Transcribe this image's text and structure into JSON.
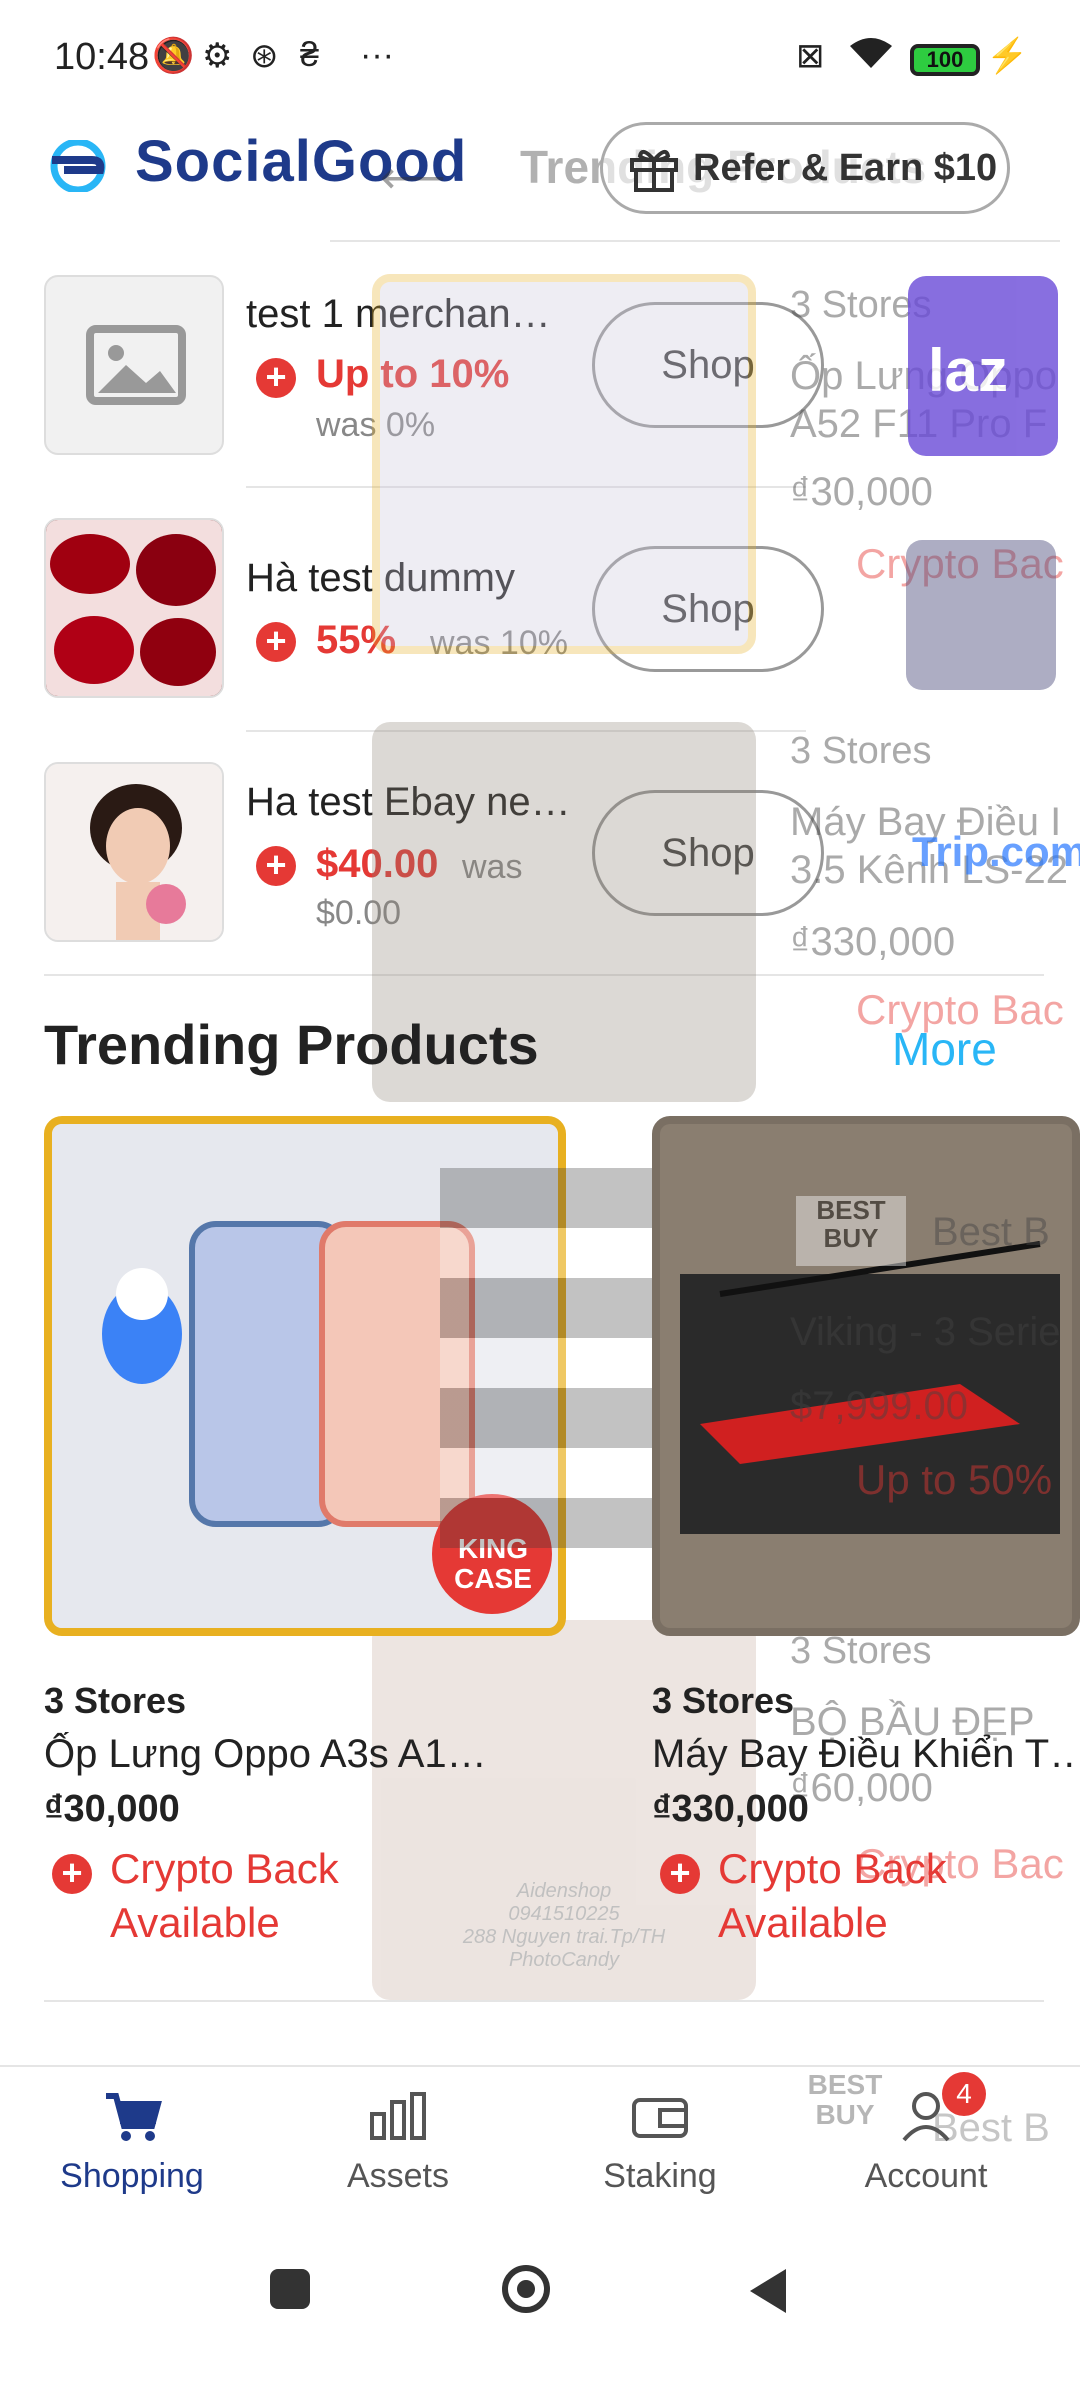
{
  "status_bar": {
    "time": "10:48",
    "battery": "100"
  },
  "header": {
    "brand": "SocialGood",
    "refer_label": "Refer & Earn $10",
    "ghost_title": "Trending Products"
  },
  "merchants": [
    {
      "name": "test 1 merchan…",
      "rate": "Up to 10%",
      "was": "was 0%",
      "shop": "Shop"
    },
    {
      "name": "Hà test dummy",
      "rate": "55%",
      "was": "was 10%",
      "shop": "Shop"
    },
    {
      "name": "Ha test Ebay ne…",
      "rate": "$40.00",
      "was": "was",
      "was2": "$0.00",
      "shop": "Shop"
    }
  ],
  "trending": {
    "title": "Trending Products",
    "more": "More",
    "products": [
      {
        "stores": "3 Stores",
        "name": "Ốp Lưng Oppo A3s A1…",
        "price": "₫30,000",
        "crypto_line1": "Crypto Back",
        "crypto_line2": "Available",
        "overlay": "KING CASE"
      },
      {
        "stores": "3 Stores",
        "name": "Máy Bay Điều Khiển T…",
        "price": "₫330,000",
        "crypto_line1": "Crypto Back",
        "crypto_line2": "Available"
      }
    ]
  },
  "ghost_right": [
    {
      "stores": "3 Stores",
      "name1": "Ốp Lưng Oppo",
      "name2": "A52 F11 Pro F",
      "price": "₫30,000",
      "crypto": "Crypto Bac",
      "logo": "laz"
    },
    {
      "stores": "3 Stores",
      "name1": "Máy Bay Điều I",
      "name2": "3.5 Kênh LS-22",
      "price": "₫330,000",
      "crypto": "Crypto Bac",
      "logo": "Trip.com"
    },
    {
      "logo": "BEST BUY",
      "brand": "Best B",
      "name": "Viking - 3 Serie",
      "price": "$7,999.00",
      "rate": "Up to 50%"
    },
    {
      "stores": "3 Stores",
      "name": "BỘ BẦU ĐẸP",
      "price": "₫60,000",
      "crypto": "Crypto Bac"
    },
    {
      "logo": "BEST BUY",
      "brand": "Best B"
    }
  ],
  "shop_image_caption": [
    "Aidenshop",
    "0941510225",
    "288 Nguyen trai.Tp/TH",
    "PhotoCandy"
  ],
  "bottom_nav": [
    {
      "label": "Shopping",
      "icon": "cart-icon",
      "active": true
    },
    {
      "label": "Assets",
      "icon": "bars-icon"
    },
    {
      "label": "Staking",
      "icon": "wallet-icon"
    },
    {
      "label": "Account",
      "icon": "user-icon",
      "badge": "4"
    }
  ],
  "colors": {
    "brand": "#1e3a8a",
    "accent_red": "#e53935",
    "link": "#29b6f6"
  }
}
